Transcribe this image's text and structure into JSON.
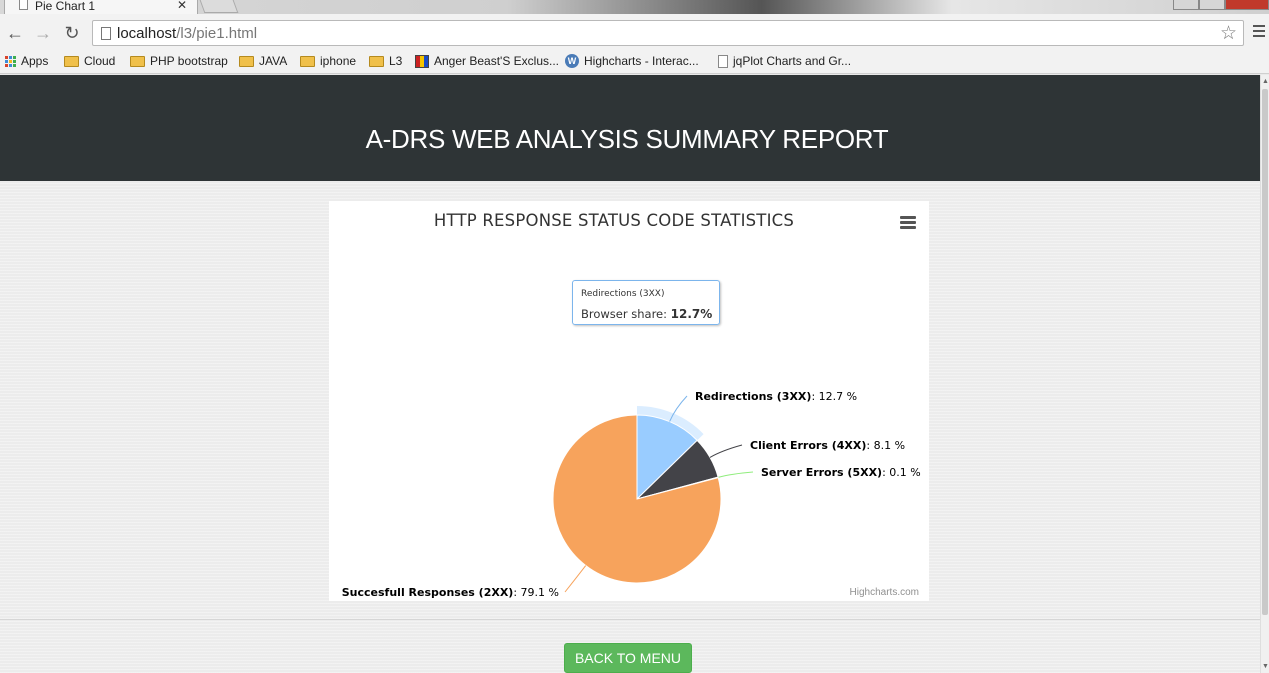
{
  "browser": {
    "tab_title": "Pie Chart 1",
    "url_host": "localhost",
    "url_path": "/l3/pie1.html",
    "bookmarks": [
      "Apps",
      "Cloud",
      "PHP bootstrap",
      "JAVA",
      "iphone",
      "L3",
      "Anger Beast'S Exclus...",
      "Highcharts - Interac...",
      "jqPlot Charts and Gr..."
    ]
  },
  "page": {
    "report_title": "A-DRS WEB ANALYSIS SUMMARY REPORT",
    "back_button": "BACK TO MENU",
    "header_color": "#2e3436",
    "button_color": "#5cb85c"
  },
  "chart": {
    "credits": "Highcharts.com",
    "tooltip": {
      "header": "Redirections (3XX)",
      "label": "Browser share:",
      "value": "12.7%"
    }
  },
  "chart_data": {
    "type": "pie",
    "title": "HTTP RESPONSE STATUS CODE STATISTICS",
    "slices": [
      {
        "name": "Redirections (3XX)",
        "value": 12.7,
        "label": "12.7 %",
        "color": "#99ccff",
        "hovered": true
      },
      {
        "name": "Client Errors (4XX)",
        "value": 8.1,
        "label": "8.1 %",
        "color": "#434348"
      },
      {
        "name": "Server Errors (5XX)",
        "value": 0.1,
        "label": "0.1 %",
        "color": "#90ed7d"
      },
      {
        "name": "Succesfull Responses (2XX)",
        "value": 79.1,
        "label": "79.1 %",
        "color": "#f7a35c"
      }
    ]
  }
}
